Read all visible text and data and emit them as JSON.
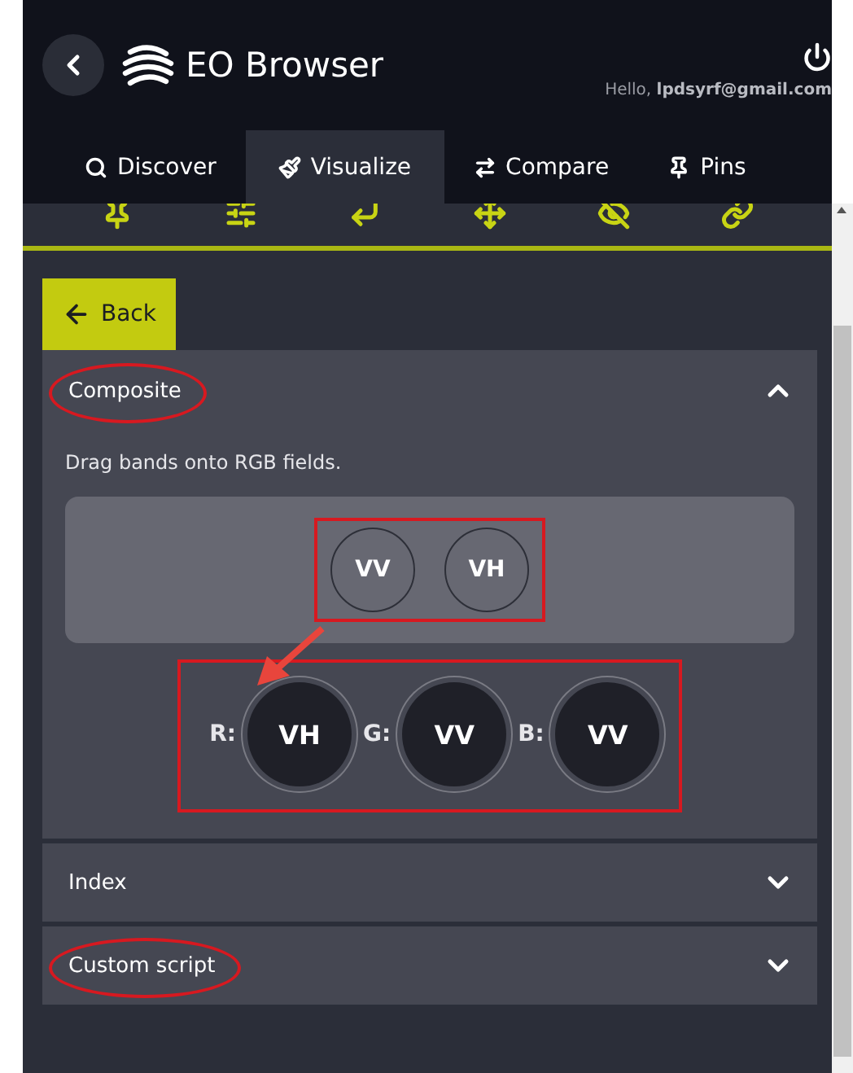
{
  "header": {
    "title": "EO Browser",
    "greeting": "Hello, ",
    "user": "lpdsyrf@gmail.com"
  },
  "tabs": [
    {
      "label": "Discover",
      "selected": false
    },
    {
      "label": "Visualize",
      "selected": true
    },
    {
      "label": "Compare",
      "selected": false
    },
    {
      "label": "Pins",
      "selected": false
    }
  ],
  "back_button": "Back",
  "sections": [
    {
      "title": "Composite",
      "expanded": true,
      "highlighted": true
    },
    {
      "title": "Index",
      "expanded": false,
      "highlighted": false
    },
    {
      "title": "Custom script",
      "expanded": false,
      "highlighted": true
    }
  ],
  "composite": {
    "hint": "Drag bands onto RGB fields.",
    "bands": [
      "VV",
      "VH"
    ],
    "bands_highlighted": true,
    "channels": [
      {
        "label": "R:",
        "band": "VH"
      },
      {
        "label": "G:",
        "band": "VV"
      },
      {
        "label": "B:",
        "band": "VV"
      }
    ],
    "channels_highlighted": true
  }
}
